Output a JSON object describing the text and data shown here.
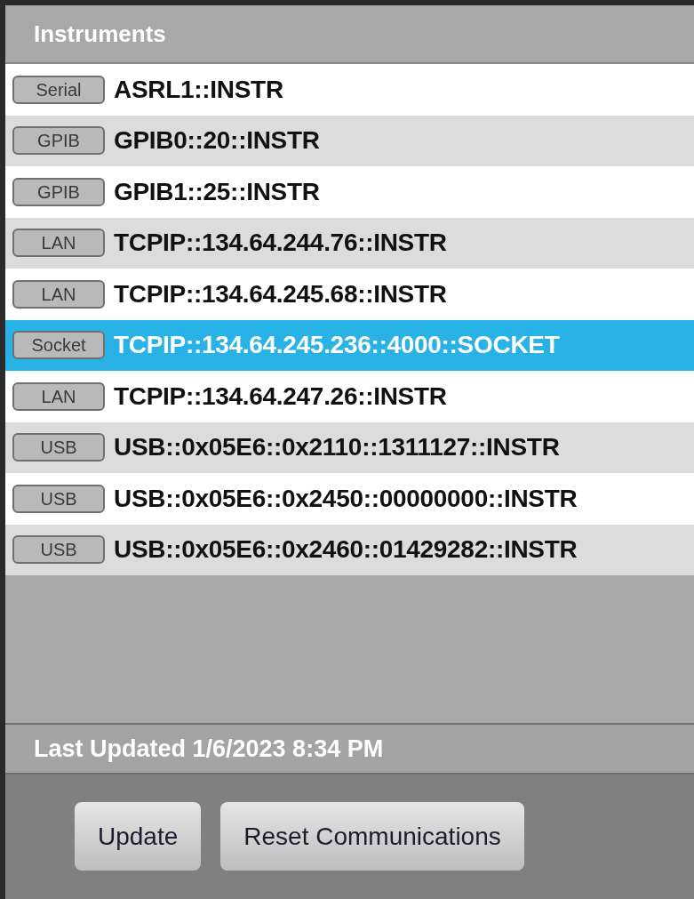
{
  "panel_title": "Instruments",
  "instruments": [
    {
      "interface": "Serial",
      "address": "ASRL1::INSTR",
      "selected": false
    },
    {
      "interface": "GPIB",
      "address": "GPIB0::20::INSTR",
      "selected": false
    },
    {
      "interface": "GPIB",
      "address": "GPIB1::25::INSTR",
      "selected": false
    },
    {
      "interface": "LAN",
      "address": "TCPIP::134.64.244.76::INSTR",
      "selected": false
    },
    {
      "interface": "LAN",
      "address": "TCPIP::134.64.245.68::INSTR",
      "selected": false
    },
    {
      "interface": "Socket",
      "address": "TCPIP::134.64.245.236::4000::SOCKET",
      "selected": true
    },
    {
      "interface": "LAN",
      "address": "TCPIP::134.64.247.26::INSTR",
      "selected": false
    },
    {
      "interface": "USB",
      "address": "USB::0x05E6::0x2110::1311127::INSTR",
      "selected": false
    },
    {
      "interface": "USB",
      "address": "USB::0x05E6::0x2450::00000000::INSTR",
      "selected": false
    },
    {
      "interface": "USB",
      "address": "USB::0x05E6::0x2460::01429282::INSTR",
      "selected": false
    }
  ],
  "status": "Last Updated 1/6/2023 8:34 PM",
  "buttons": [
    "Update",
    "Reset Communications"
  ]
}
